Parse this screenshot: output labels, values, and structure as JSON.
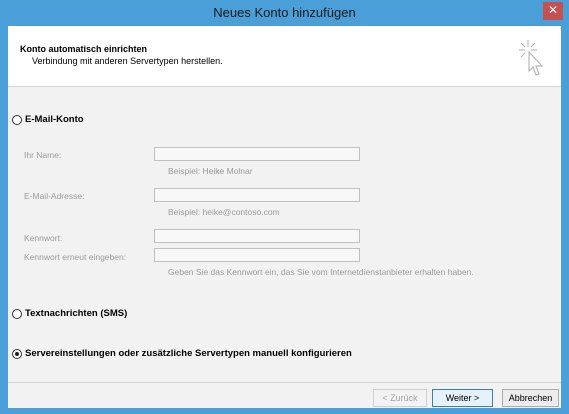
{
  "window": {
    "title": "Neues Konto hinzufügen",
    "close_glyph": "✕"
  },
  "header": {
    "title": "Konto automatisch einrichten",
    "subtitle": "Verbindung mit anderen Servertypen herstellen."
  },
  "options": {
    "email": {
      "label": "E-Mail-Konto",
      "selected": false
    },
    "sms": {
      "label": "Textnachrichten (SMS)",
      "selected": false
    },
    "manual": {
      "label": "Servereinstellungen oder zusätzliche Servertypen manuell konfigurieren",
      "selected": true
    }
  },
  "form": {
    "name": {
      "label": "Ihr Name:",
      "value": "",
      "hint": "Beispiel: Heike Molnar"
    },
    "email": {
      "label": "E-Mail-Adresse:",
      "value": "",
      "hint": "Beispiel: heike@contoso.com"
    },
    "password": {
      "label": "Kennwort:",
      "value": ""
    },
    "password_confirm": {
      "label": "Kennwort erneut eingeben:",
      "value": "",
      "hint": "Geben Sie das Kennwort ein, das Sie vom Internetdienstanbieter erhalten haben."
    }
  },
  "buttons": {
    "back": "< Zurück",
    "next": "Weiter >",
    "cancel": "Abbrechen"
  }
}
